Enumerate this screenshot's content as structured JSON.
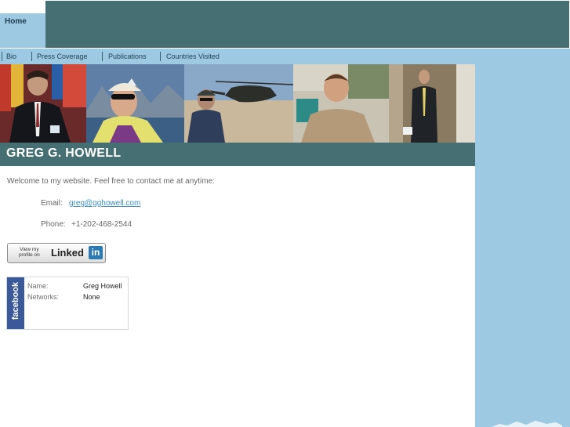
{
  "nav": {
    "home": "Home",
    "items": [
      "Bio",
      "Press Coverage",
      "Publications",
      "Countries Visited"
    ]
  },
  "profile": {
    "name": "GREG G. HOWELL",
    "welcome": "Welcome to my website.  Feel free to contact me at anytime:",
    "email_label": "Email:",
    "email": "greg@gghowell.com",
    "phone_label": "Phone:",
    "phone": "+1-202-468-2544"
  },
  "linkedin": {
    "view_line1": "View my",
    "view_line2": "profile on",
    "brand": "Linked",
    "in": "in"
  },
  "facebook": {
    "brand": "facebook",
    "name_label": "Name:",
    "name_value": "Greg Howell",
    "networks_label": "Networks:",
    "networks_value": "None"
  },
  "colors": {
    "header_teal": "#466f74",
    "nav_blue": "#9ec9e3",
    "link_blue": "#3b8cc4",
    "facebook_blue": "#3b5998",
    "linkedin_blue": "#2c7ab4"
  }
}
